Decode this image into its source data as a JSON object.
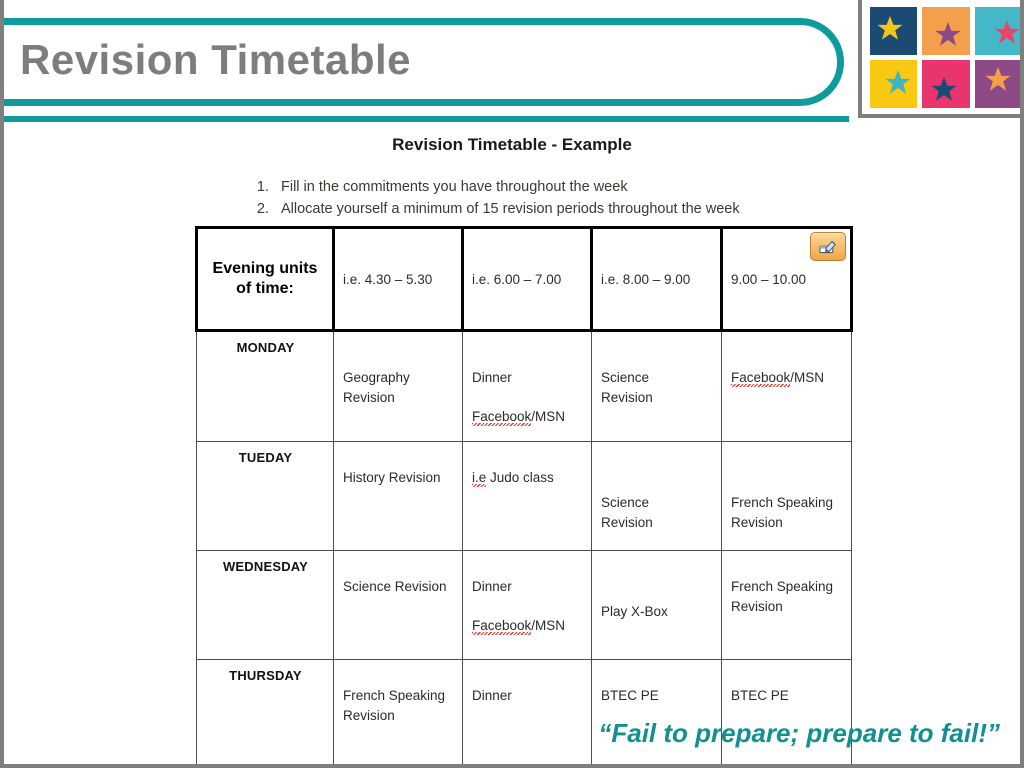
{
  "slide": {
    "title": "Revision Timetable",
    "accent_teal": "#0d9b9b",
    "title_color": "#7d7d7d"
  },
  "logo": {
    "name": "star-tiles-logo",
    "tiles": [
      {
        "bg": "#1b4a72",
        "star": "#f5c518"
      },
      {
        "bg": "#f2a04c",
        "star": "#8d4a86"
      },
      {
        "bg": "#45b8c8",
        "star": "#e8456b"
      },
      {
        "bg": "#f8c812",
        "star": "#3fb5c4"
      },
      {
        "bg": "#e8356d",
        "star": "#1b4a72"
      },
      {
        "bg": "#8d4a86",
        "star": "#f2a04c"
      }
    ]
  },
  "document": {
    "title": "Revision Timetable - Example",
    "instructions": [
      "Fill in the commitments you have throughout the week",
      "Allocate yourself a minimum of 15 revision periods throughout the week"
    ]
  },
  "timetable": {
    "headers": [
      "Evening units of time:",
      "i.e. 4.30 – 5.30",
      "i.e. 6.00 – 7.00",
      "i.e. 8.00 – 9.00",
      "9.00 – 10.00"
    ],
    "header_first_line_1": "Evening units",
    "header_first_line_2": "of time:",
    "edit_button_icon": "edit-icon",
    "rows": [
      {
        "day": "MONDAY",
        "slot1_line1": "Geography",
        "slot1_line2": "Revision",
        "slot2_line1": "Dinner",
        "slot2_line2": "Facebook",
        "slot2_line2_suffix": "/MSN",
        "slot3_line1": "Science",
        "slot3_line2": "Revision",
        "slot4_line1": "Facebook",
        "slot4_line1_suffix": "/MSN"
      },
      {
        "day": "TUEDAY",
        "slot1_line1": "History Revision",
        "slot2_prefix": "i.e",
        "slot2_line1": " Judo class",
        "slot3_line1": "Science",
        "slot3_line2": "Revision",
        "slot4_line1": "French Speaking",
        "slot4_line2": "Revision"
      },
      {
        "day": "WEDNESDAY",
        "slot1_line1": "Science Revision",
        "slot2_line1": "Dinner",
        "slot2_line2": "Facebook",
        "slot2_line2_suffix": "/MSN",
        "slot3_line1": "Play X-Box",
        "slot4_line1": "French Speaking",
        "slot4_line2": "Revision"
      },
      {
        "day": "THURSDAY",
        "slot1_line1": "French Speaking",
        "slot1_line2": "Revision",
        "slot2_line1": "Dinner",
        "slot3_line1": "BTEC PE",
        "slot4_line1": "BTEC PE"
      }
    ]
  },
  "footer": {
    "quote": "“Fail to prepare; prepare to fail!”",
    "quote_color": "#10918f"
  }
}
